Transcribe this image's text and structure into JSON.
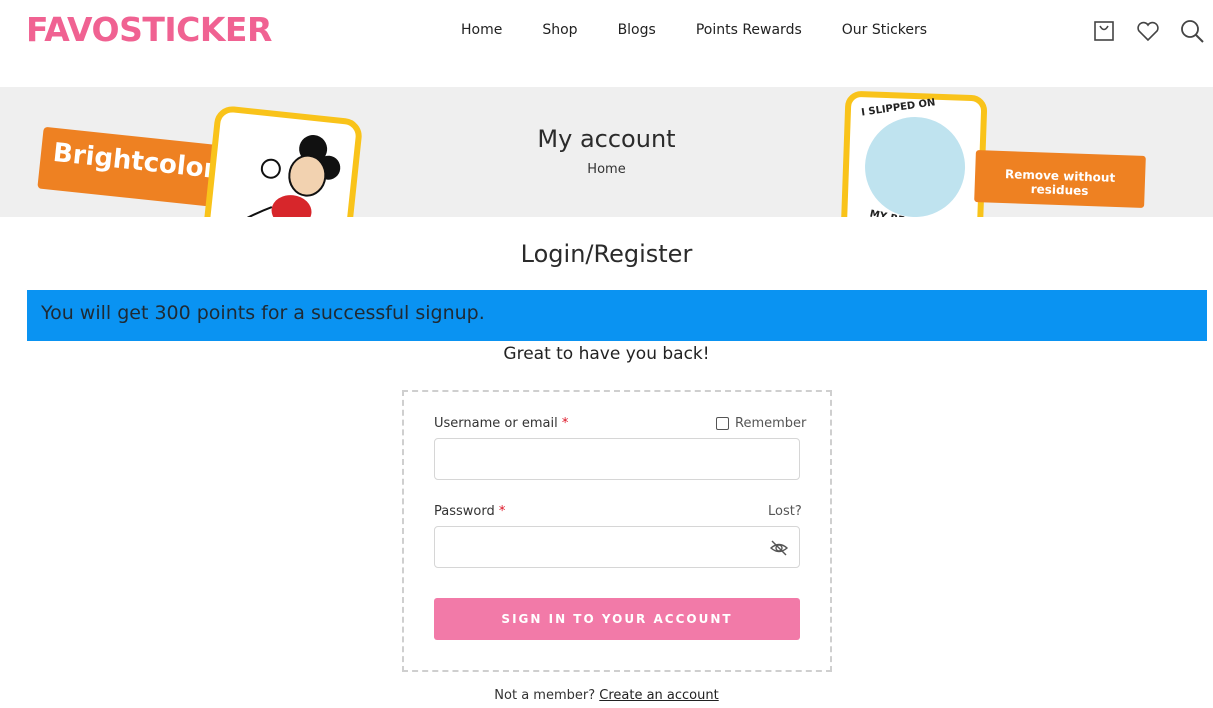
{
  "header": {
    "logo_text": "FAVOSTICKER",
    "nav": [
      "Home",
      "Shop",
      "Blogs",
      "Points Rewards",
      "Our Stickers"
    ],
    "icons": [
      "bag-icon",
      "heart-icon",
      "search-icon"
    ],
    "brand_color": "#f06292"
  },
  "banner": {
    "title": "My account",
    "breadcrumb": "Home",
    "left_tag": "Brightcolor",
    "right_tag": "Remove without residues",
    "sticker_text_top": "I SLIPPED ON",
    "sticker_text_bottom": "MY BEANS"
  },
  "main": {
    "heading": "Login/Register",
    "notice": "You will get 300 points for a successful signup.",
    "welcome": "Great to have you back!",
    "notice_color": "#0a93f2"
  },
  "form": {
    "username_label": "Username or email",
    "required_mark": "*",
    "remember_label": "Remember",
    "password_label": "Password",
    "lost_label": "Lost?",
    "submit_label": "SIGN IN TO YOUR ACCOUNT",
    "submit_color": "#f27aa8",
    "username_value": "",
    "password_value": ""
  },
  "footer": {
    "member_text": "Not a member?",
    "create_link": "Create an account"
  }
}
